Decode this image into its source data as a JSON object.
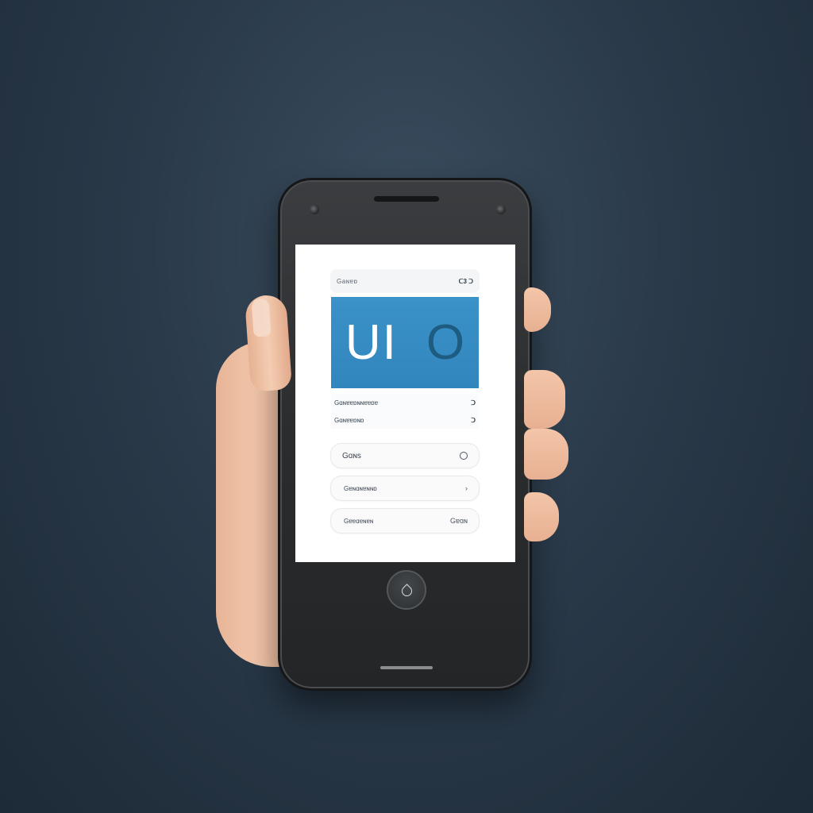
{
  "screen": {
    "status_bar": {
      "left": "Gaɴɐɒ",
      "right": "ᑕ3 ᑐ"
    },
    "hero": {
      "left_text": "UI",
      "right_text": "O"
    },
    "info_rows": [
      {
        "label": "Gɑɴɐɐɒɴɴɐɐɒɐ",
        "value": "ᑐ"
      },
      {
        "label": "Gɑɴɐɐɒɴɒ",
        "value": "ᑐ"
      }
    ],
    "list_items": [
      {
        "label": "Gɑɴs"
      },
      {
        "label": "Gɐɴɑɴɐɴɴɒ",
        "trail": "›"
      },
      {
        "label": "Gɐɐɑɐɴɐɴ",
        "trail": "Gɐɑɴ"
      }
    ]
  },
  "colors": {
    "hero_bg": "#3288c0",
    "hero_text": "#ffffff",
    "hero_accent": "#1d5b80",
    "background": "#2a3a4a"
  },
  "icons": {
    "home_button": "drop-icon",
    "item_1_trail": "circle-toggle-icon"
  }
}
